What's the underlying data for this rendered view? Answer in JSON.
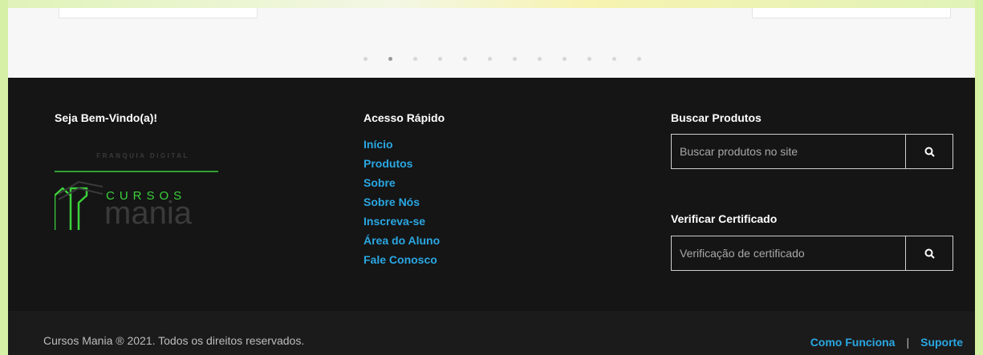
{
  "carousel": {
    "dot_count": 12,
    "active_index": 1
  },
  "footer": {
    "welcome_title": "Seja Bem-Vindo(a)!",
    "logo": {
      "tagline": "FRANQUIA DIGITAL",
      "word_top": "CURSOS",
      "word_bottom": "mania"
    },
    "quick_access": {
      "title": "Acesso Rápido",
      "links": [
        "Início",
        "Produtos",
        "Sobre",
        "Sobre Nós",
        "Inscreva-se",
        "Área do Aluno",
        "Fale Conosco"
      ]
    },
    "search_products": {
      "title": "Buscar Produtos",
      "placeholder": "Buscar produtos no site"
    },
    "verify_certificate": {
      "title": "Verificar Certificado",
      "placeholder": "Verificação de certificado"
    }
  },
  "bottom_bar": {
    "copyright": "Cursos Mania ® 2021. Todos os direitos reservados.",
    "links": [
      "Como Funciona",
      "Suporte"
    ],
    "separator": "|"
  },
  "colors": {
    "link": "#2aa7e3",
    "footer_bg": "#151515",
    "logo_green": "#3bd13b",
    "logo_gray": "#3a3a3a"
  },
  "icons": {
    "search": "search-icon"
  }
}
